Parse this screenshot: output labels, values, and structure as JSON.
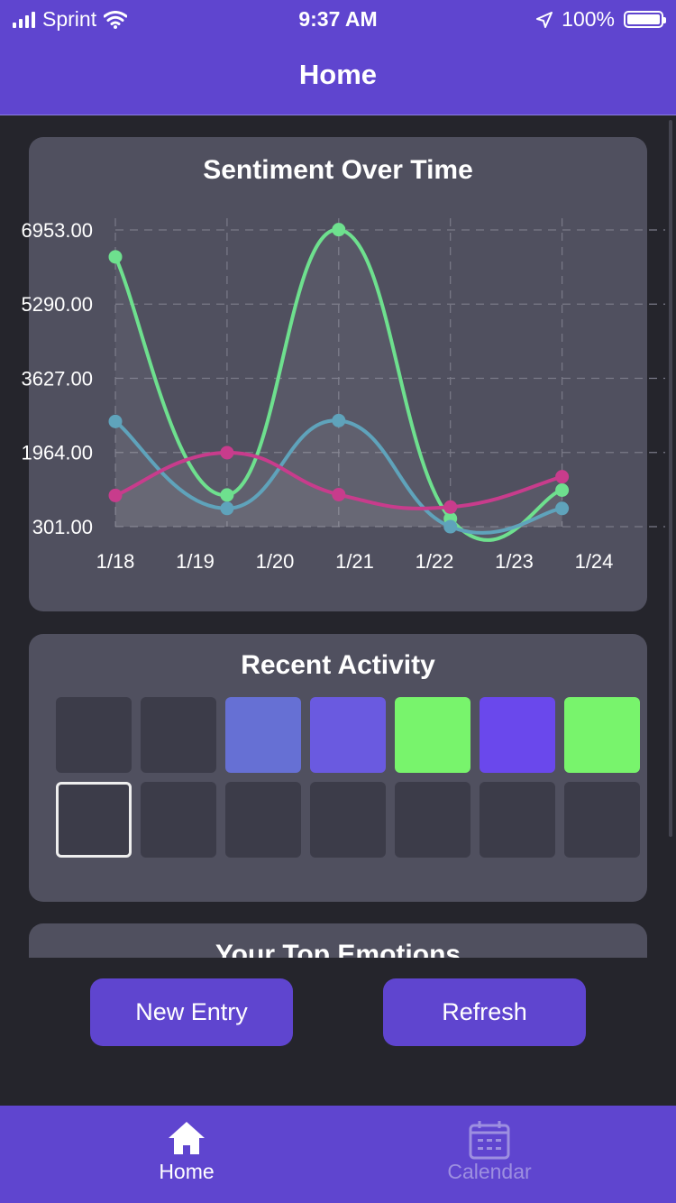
{
  "status_bar": {
    "carrier": "Sprint",
    "time": "9:37 AM",
    "battery": "100%"
  },
  "nav": {
    "title": "Home"
  },
  "sentiment_card": {
    "title": "Sentiment Over Time"
  },
  "chart_data": {
    "type": "line",
    "title": "Sentiment Over Time",
    "xlabel": "",
    "ylabel": "",
    "x_tick_labels": [
      "1/18",
      "1/19",
      "1/20",
      "1/21",
      "1/22",
      "1/23",
      "1/24"
    ],
    "y_ticks": [
      301.0,
      1964.0,
      3627.0,
      5290.0,
      6953.0
    ],
    "y_tick_labels": [
      "301.00",
      "1964.00",
      "3627.00",
      "5290.00",
      "6953.00"
    ],
    "ylim": [
      301,
      6953
    ],
    "grid": true,
    "smooth": true,
    "series": [
      {
        "color": "#6ee08e",
        "points": [
          [
            0,
            6350
          ],
          [
            1.4,
            1010
          ],
          [
            2.8,
            6960
          ],
          [
            4.2,
            480
          ],
          [
            5.6,
            1120
          ]
        ]
      },
      {
        "color": "#5fa3bb",
        "points": [
          [
            0,
            2660
          ],
          [
            1.4,
            710
          ],
          [
            2.8,
            2680
          ],
          [
            4.2,
            300
          ],
          [
            5.6,
            710
          ]
        ]
      },
      {
        "color": "#c83c8c",
        "points": [
          [
            0,
            1000
          ],
          [
            1.4,
            1960
          ],
          [
            2.8,
            1020
          ],
          [
            4.2,
            740
          ],
          [
            5.6,
            1420
          ]
        ]
      }
    ]
  },
  "activity_card": {
    "title": "Recent Activity",
    "cells": [
      {
        "color": "#3c3c49"
      },
      {
        "color": "#3c3c49"
      },
      {
        "color": "#6670d4"
      },
      {
        "color": "#6a5ae0"
      },
      {
        "color": "#78f46c"
      },
      {
        "color": "#6a48ec"
      },
      {
        "color": "#78f46c"
      },
      {
        "color": "#3c3c49",
        "today": true
      },
      {
        "color": "#3c3c49"
      },
      {
        "color": "#3c3c49"
      },
      {
        "color": "#3c3c49"
      },
      {
        "color": "#3c3c49"
      },
      {
        "color": "#3c3c49"
      },
      {
        "color": "#3c3c49"
      }
    ]
  },
  "emotions_card": {
    "title": "Your Top Emotions"
  },
  "buttons": {
    "new_entry": "New Entry",
    "refresh": "Refresh"
  },
  "tabs": {
    "home": "Home",
    "calendar": "Calendar"
  }
}
